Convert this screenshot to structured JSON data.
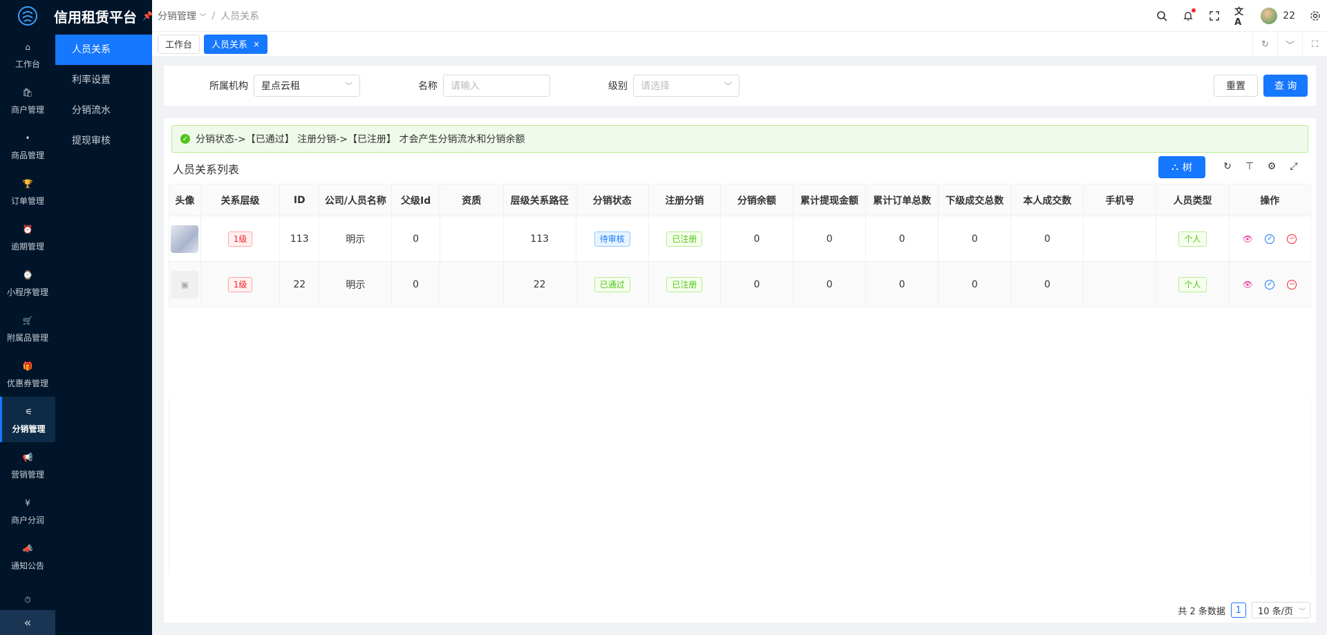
{
  "app": {
    "title": "信用租赁平台"
  },
  "rail": [
    {
      "label": "工作台",
      "icon": "home-icon"
    },
    {
      "label": "商户管理",
      "icon": "bag-icon"
    },
    {
      "label": "商品管理",
      "icon": "apple-icon"
    },
    {
      "label": "订单管理",
      "icon": "trophy-icon"
    },
    {
      "label": "逾期管理",
      "icon": "alarm-icon"
    },
    {
      "label": "小程序管理",
      "icon": "watch-icon"
    },
    {
      "label": "附属品管理",
      "icon": "cart-icon"
    },
    {
      "label": "优惠券管理",
      "icon": "gift-icon"
    },
    {
      "label": "分销管理",
      "icon": "sliders-icon",
      "active": true
    },
    {
      "label": "营销管理",
      "icon": "megaphone-icon"
    },
    {
      "label": "商户分润",
      "icon": "yen-icon"
    },
    {
      "label": "通知公告",
      "icon": "notice-icon"
    },
    {
      "label": "",
      "icon": "clock-icon"
    }
  ],
  "subnav": [
    "人员关系",
    "利率设置",
    "分销流水",
    "提现审核"
  ],
  "breadcrumb": {
    "parent": "分销管理",
    "current": "人员关系"
  },
  "user": {
    "name": "22"
  },
  "tabs": [
    "工作台",
    "人员关系"
  ],
  "filter": {
    "org_label": "所属机构",
    "org_value": "星点云租",
    "name_label": "名称",
    "name_placeholder": "请输入",
    "level_label": "级别",
    "level_placeholder": "请选择",
    "reset": "重置",
    "search": "查 询"
  },
  "alert": "分销状态->【已通过】 注册分销->【已注册】 才会产生分销流水和分销余额",
  "list": {
    "title": "人员关系列表",
    "tree_button": "树",
    "columns": [
      "头像",
      "关系层级",
      "ID",
      "公司/人员名称",
      "父级Id",
      "资质",
      "层级关系路径",
      "分销状态",
      "注册分销",
      "分销余额",
      "累计提现金额",
      "累计订单总数",
      "下级成交总数",
      "本人成交数",
      "手机号",
      "人员类型",
      "操作"
    ],
    "rows": [
      {
        "level": "1级",
        "id": "113",
        "name": "明示",
        "parent": "0",
        "qual": "",
        "path": "113",
        "status": "待审核",
        "status_color": "blue",
        "reg": "已注册",
        "balance": "0",
        "withdraw": "0",
        "orders": "0",
        "sub_deals": "0",
        "own_deals": "0",
        "phone": "",
        "type": "个人"
      },
      {
        "level": "1级",
        "id": "22",
        "name": "明示",
        "parent": "0",
        "qual": "",
        "path": "22",
        "status": "已通过",
        "status_color": "green",
        "reg": "已注册",
        "balance": "0",
        "withdraw": "0",
        "orders": "0",
        "sub_deals": "0",
        "own_deals": "0",
        "phone": "",
        "type": "个人"
      }
    ]
  },
  "pagination": {
    "total": "共 2 条数据",
    "page": "1",
    "size": "10 条/页"
  }
}
